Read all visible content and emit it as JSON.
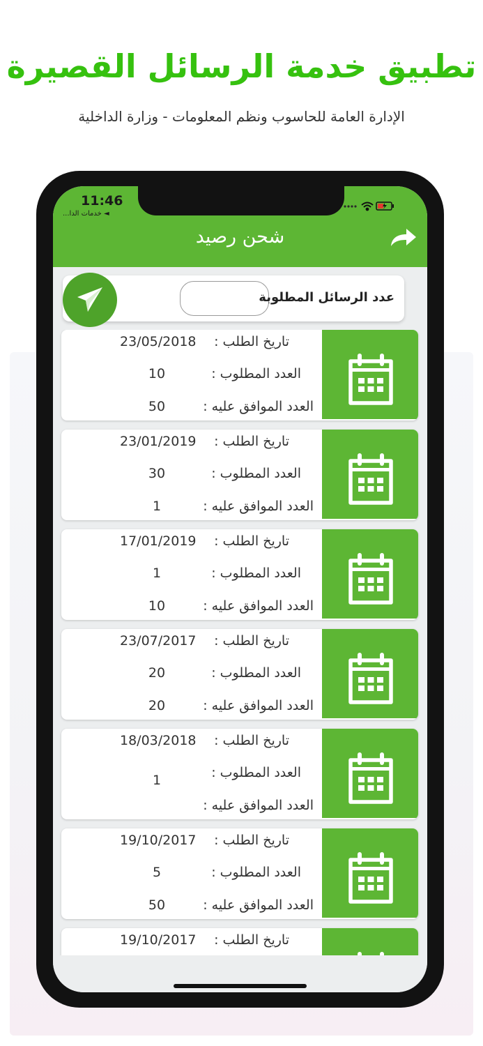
{
  "promo": {
    "headline": "تطبيق خدمة الرسائل القصيرة",
    "subheadline": "الإدارة العامة للحاسوب ونظم المعلومات - وزارة الداخلية"
  },
  "status_bar": {
    "time": "11:46",
    "back_app": "◄ خدمات الدا..."
  },
  "app_bar": {
    "title": "شحن رصيد",
    "share_icon": "share-arrow-icon"
  },
  "request": {
    "label": "عدد الرسائل المطلوبة",
    "input_value": "",
    "send_icon": "paper-plane-icon"
  },
  "labels": {
    "date": "تاريخ الطلب :",
    "requested": "العدد المطلوب :",
    "approved": "العدد الموافق عليه :"
  },
  "requests": [
    {
      "date": "23/05/2018",
      "requested": "10",
      "approved": "50"
    },
    {
      "date": "23/01/2019",
      "requested": "30",
      "approved": "1"
    },
    {
      "date": "17/01/2019",
      "requested": "1",
      "approved": "10"
    },
    {
      "date": "23/07/2017",
      "requested": "20",
      "approved": "20"
    },
    {
      "date": "18/03/2018",
      "requested": "1",
      "approved": ""
    },
    {
      "date": "19/10/2017",
      "requested": "5",
      "approved": "50"
    },
    {
      "date": "19/10/2017",
      "requested": "",
      "approved": ""
    }
  ],
  "colors": {
    "headline_green": "#36c10f",
    "app_green": "#5db634",
    "send_green": "#4ea32a"
  }
}
